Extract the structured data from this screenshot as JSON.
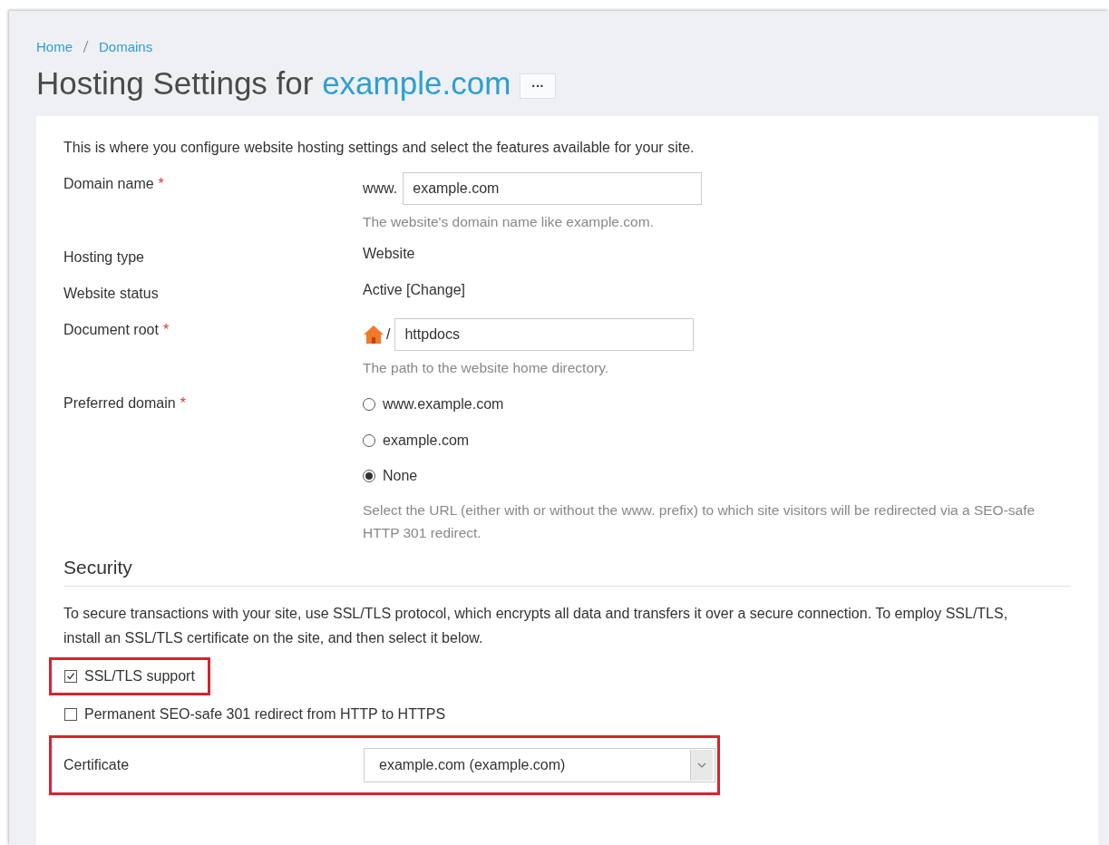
{
  "breadcrumbs": [
    "Home",
    "Domains"
  ],
  "title": {
    "text": "Hosting Settings for",
    "domain": "example.com",
    "more_button": "···"
  },
  "intro": "This is where you configure website hosting settings and select the features available for your site.",
  "fields": [
    {
      "kind": "prefixed_input",
      "label": "Domain name",
      "required_mark": "*",
      "prefix": "www.",
      "value": "example.com",
      "hint": "The website's domain name like example.com."
    },
    {
      "kind": "text",
      "label": "Hosting type",
      "value": "Website"
    },
    {
      "kind": "status",
      "label": "Website status",
      "value": "Active",
      "link": "[Change]"
    },
    {
      "kind": "path_input",
      "label": "Document root",
      "required_mark": "*",
      "separator": "/",
      "value": "httpdocs",
      "hint": "The path to the website home directory."
    },
    {
      "kind": "radios",
      "label": "Preferred domain",
      "required_mark": "*",
      "options": [
        {
          "label": "www.example.com",
          "selected": false
        },
        {
          "label": "example.com",
          "selected": false
        },
        {
          "label": "None",
          "selected": true
        }
      ],
      "hint": "Select the URL (either with or without the www. prefix) to which site visitors will be redirected via a SEO-safe HTTP 301 redirect."
    }
  ],
  "security": {
    "heading": "Security",
    "description": "To secure transactions with your site, use SSL/TLS protocol, which encrypts all data and transfers it over a secure connection. To employ SSL/TLS, install an SSL/TLS certificate on the site, and then select it below.",
    "checkboxes": [
      {
        "label": "SSL/TLS support",
        "checked": true,
        "highlighted": true
      },
      {
        "label": "Permanent SEO-safe 301 redirect from HTTP to HTTPS",
        "checked": false,
        "highlighted": false
      }
    ],
    "certificate": {
      "label": "Certificate",
      "value": "example.com (example.com)",
      "highlighted": true
    }
  }
}
